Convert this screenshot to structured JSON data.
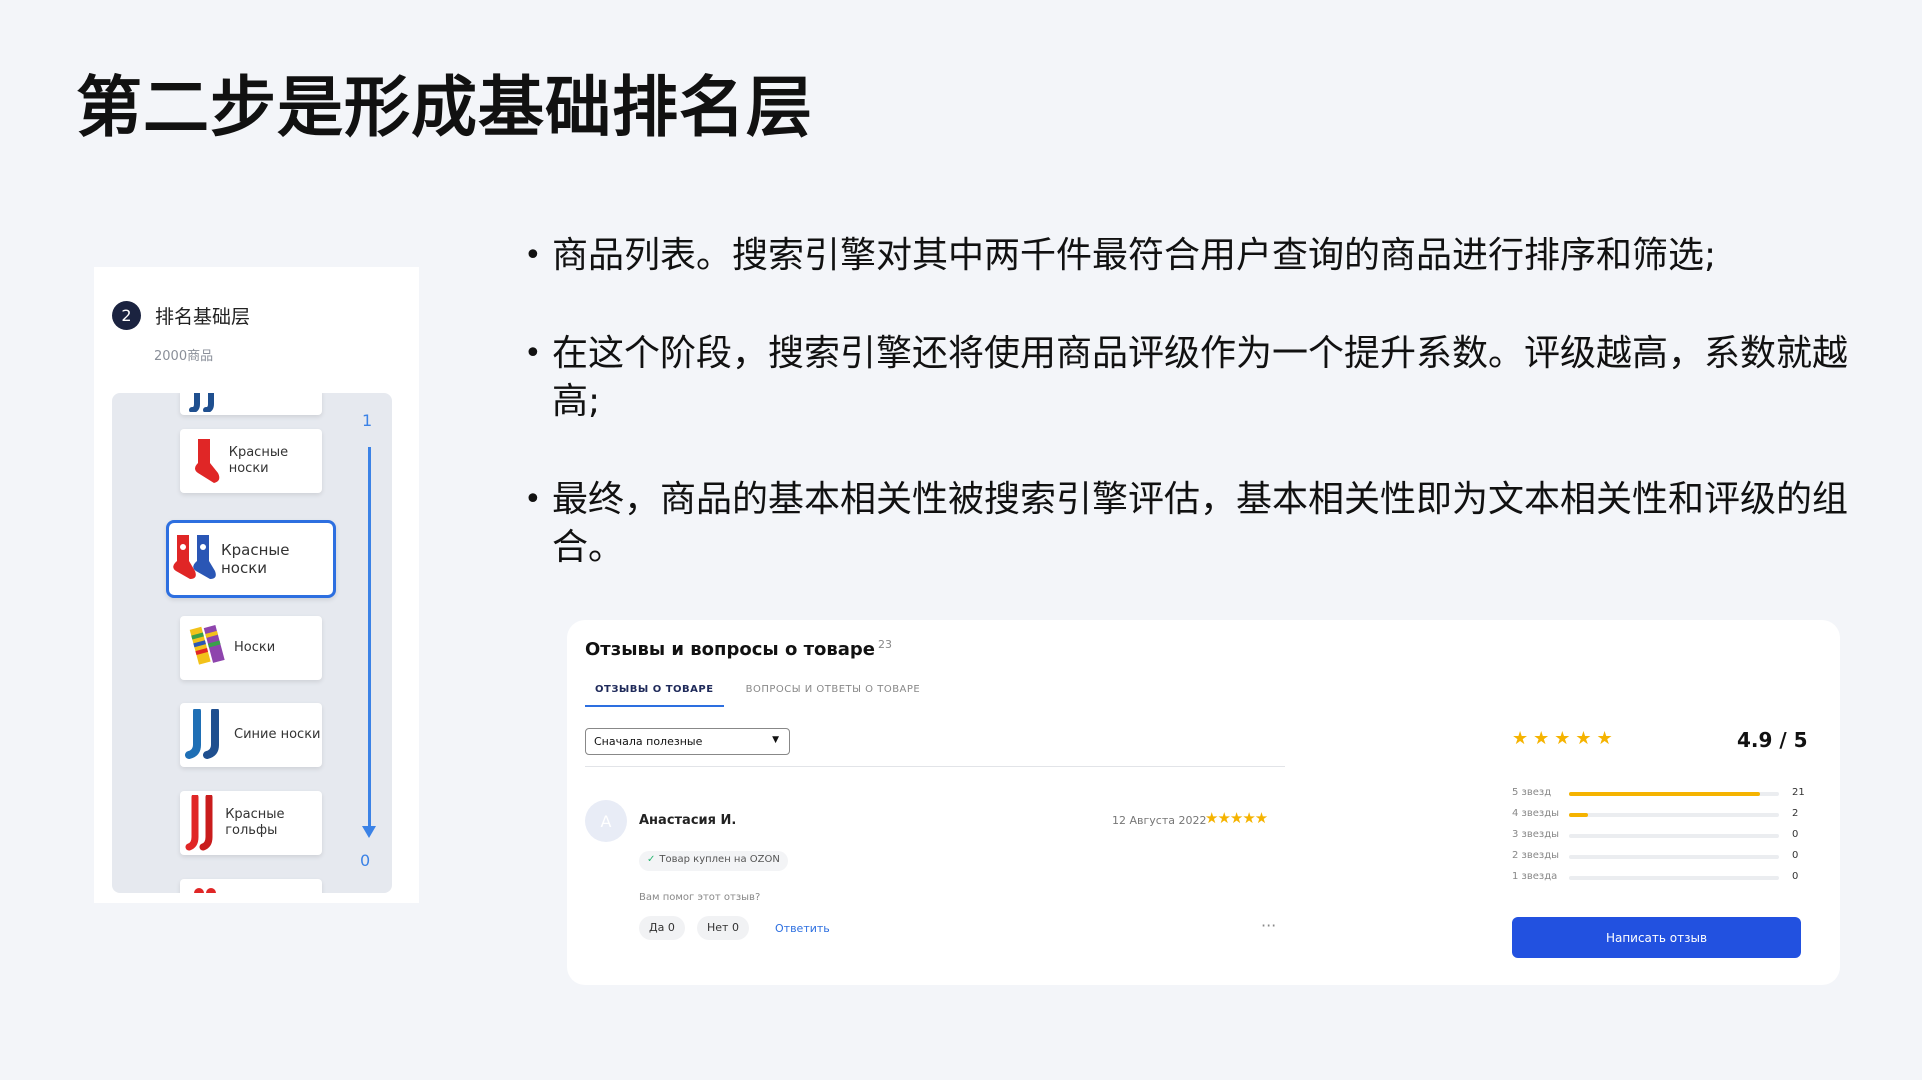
{
  "title": "第二步是形成基础排名层",
  "panel": {
    "step_number": "2",
    "title": "排名基础层",
    "subtitle": "2000商品",
    "rank_top": "1",
    "rank_bottom": "0",
    "products": [
      {
        "label": "Красные носки",
        "icon": "red-sock-icon"
      },
      {
        "label": "Красные носки",
        "icon": "patterned-socks-icon",
        "selected": true
      },
      {
        "label": "Носки",
        "icon": "striped-socks-icon"
      },
      {
        "label": "Синие носки",
        "icon": "blue-socks-icon"
      },
      {
        "label": "Красные гольфы",
        "icon": "red-knee-socks-icon"
      }
    ]
  },
  "bullets": [
    "商品列表。搜索引擎对其中两千件最符合用户查询的商品进行排序和筛选;",
    "在这个阶段，搜索引擎还将使用商品评级作为一个提升系数。评级越高，系数就越高;",
    "最终，商品的基本相关性被搜索引擎评估，基本相关性即为文本相关性和评级的组合。"
  ],
  "reviews": {
    "title": "Отзывы и вопросы о товаре",
    "count": "23",
    "tabs": [
      "ОТЗЫВЫ О ТОВАРЕ",
      "ВОПРОСЫ И ОТВЕТЫ О ТОВАРЕ"
    ],
    "sort_value": "Сначала полезные",
    "review": {
      "avatar_letter": "А",
      "author": "Анастасия И.",
      "date": "12 Августа 2022",
      "stars": "★★★★★",
      "badge": "Товар куплен на OZON",
      "helpful_prompt": "Вам помог этот отзыв?",
      "yes": "Да 0",
      "no": "Нет 0",
      "reply": "Ответить",
      "more": "···"
    },
    "summary_stars": "★★★★★",
    "score": "4.9 / 5",
    "distribution": [
      {
        "label": "5 звезд",
        "count": "21",
        "fraction": 0.91
      },
      {
        "label": "4 звезды",
        "count": "2",
        "fraction": 0.09
      },
      {
        "label": "3 звезды",
        "count": "0",
        "fraction": 0
      },
      {
        "label": "2 звезды",
        "count": "0",
        "fraction": 0
      },
      {
        "label": "1 звезда",
        "count": "0",
        "fraction": 0
      }
    ],
    "write_button": "Написать отзыв"
  },
  "colors": {
    "accent_blue": "#2d6fe0",
    "button_blue": "#2251e0",
    "star_yellow": "#f5b300",
    "badge_dark": "#1b2340"
  }
}
